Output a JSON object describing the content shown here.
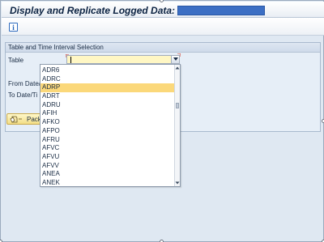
{
  "window": {
    "title": "Display and Replicate Logged Data:"
  },
  "toolbar": {
    "info_icon": "info-icon",
    "info_glyph": "i"
  },
  "selection_panel": {
    "header": "Table and Time Interval Selection",
    "table_label": "Table",
    "table_value": "",
    "from_label": "From Date/",
    "to_label": "To Date/Ti",
    "package_label": "Packa",
    "package_icon": "package-icon"
  },
  "dropdown": {
    "selected": "ADRP",
    "items": [
      "ADR6",
      "ADRC",
      "ADRP",
      "ADRT",
      "ADRU",
      "AFIH",
      "AFKO",
      "AFPO",
      "AFRU",
      "AFVC",
      "AFVU",
      "AFVV",
      "ANEA",
      "ANEK"
    ]
  },
  "colors": {
    "title_field": "#3c6fc4",
    "selected_row": "#fbd87a",
    "input_background": "#fff7c4",
    "background": "#dfe8f2"
  }
}
